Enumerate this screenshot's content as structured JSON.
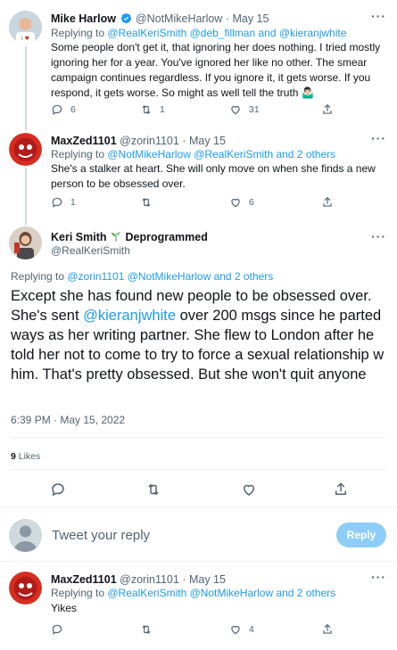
{
  "tweets": [
    {
      "name": "Mike Harlow",
      "handle": "@NotMikeHarlow",
      "date": "· May 15",
      "reply_prefix": "Replying to ",
      "reply_mentions": "@RealKeriSmith @deb_fillman and @kieranjwhite",
      "body": "Some people don't get it, that ignoring her does nothing. I tried mostly ignoring her for a year. You've ignored her like no other. The smear campaign continues regardless. If you ignore it, it gets worse. If you respond, it gets worse. So might as well tell the truth 🤷🏻‍♂️",
      "replies": "6",
      "retweets": "1",
      "likes": "31"
    },
    {
      "name": "MaxZed1101",
      "handle": "@zorin1101",
      "date": "· May 15",
      "reply_prefix": "Replying to ",
      "reply_mentions": "@NotMikeHarlow @RealKeriSmith and 2 others",
      "body": "She's a stalker at heart. She will only move on when she finds a new person to be obsessed over.",
      "replies": "1",
      "retweets": "",
      "likes": "6"
    }
  ],
  "main": {
    "name": "Keri Smith",
    "name_suffix": "Deprogrammed",
    "handle": "@RealKeriSmith",
    "reply_prefix": "Replying to ",
    "reply_mentions": "@zorin1101 @NotMikeHarlow and 2 others",
    "body_pre": "Except she has found new people to be obsessed over. She's sent ",
    "body_mention": "@kieranjwhite",
    "body_post": " over 200 msgs since he parted ways as her writing partner. She flew to London after he told her not to come to try to force a sexual relationship w him. That's pretty obsessed. But she won't quit anyone",
    "timestamp": "6:39 PM · May 15, 2022",
    "likes_count": "9",
    "likes_label": "Likes"
  },
  "compose": {
    "placeholder": "Tweet your reply",
    "button": "Reply"
  },
  "bottom_tweet": {
    "name": "MaxZed1101",
    "handle": "@zorin1101",
    "date": "· May 15",
    "reply_prefix": "Replying to ",
    "reply_mentions": "@RealKeriSmith @NotMikeHarlow and 2 others",
    "body": "Yikes",
    "replies": "",
    "retweets": "",
    "likes": "4"
  },
  "more_glyph": "···",
  "colors": {
    "accent": "#1d9bf0",
    "text": "#0f1419",
    "muted": "#536471",
    "reply_button": "#8ecdf8"
  },
  "icons": [
    "reply-icon",
    "retweet-icon",
    "like-icon",
    "share-icon",
    "verified-icon",
    "sprout-icon"
  ]
}
